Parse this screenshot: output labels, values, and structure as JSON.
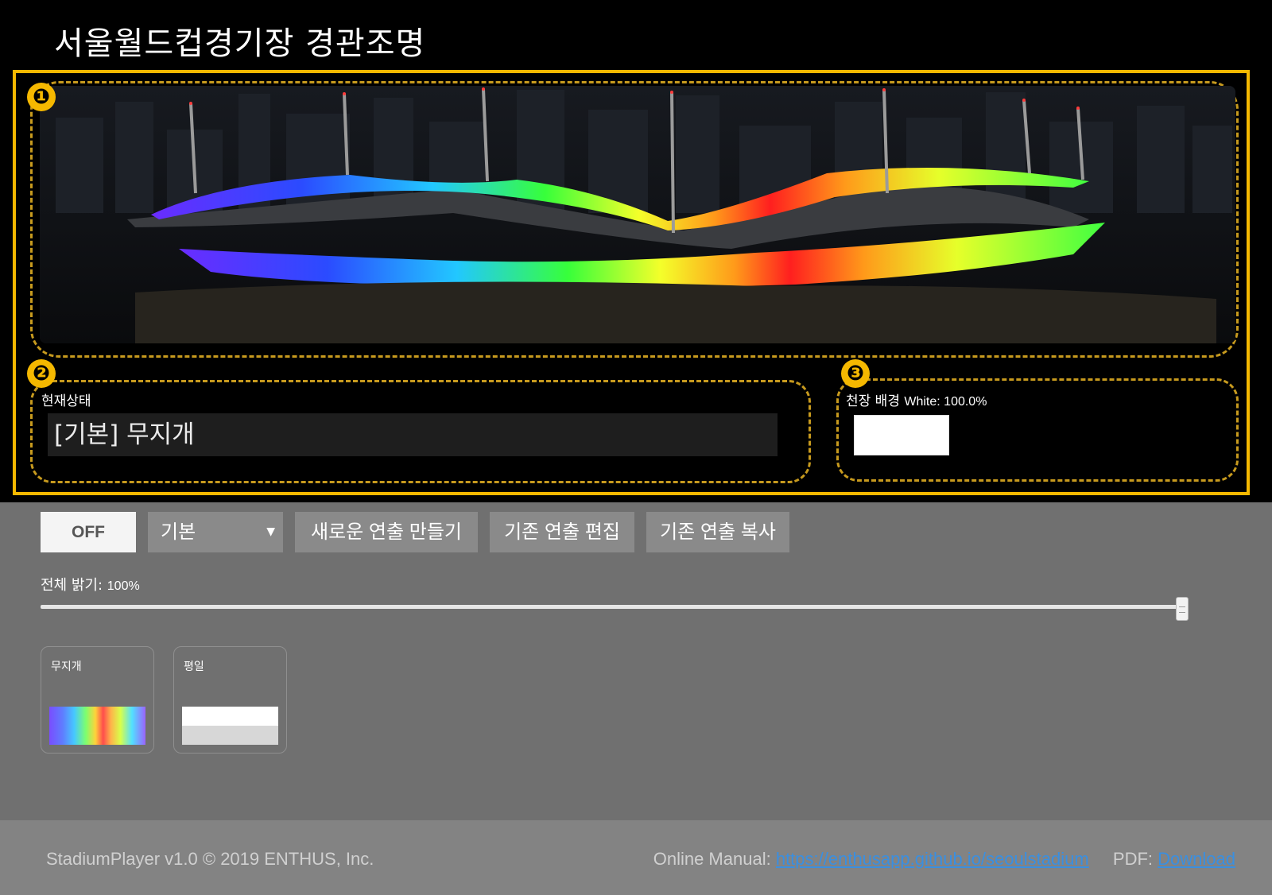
{
  "app": {
    "title": "서울월드컵경기장 경관조명"
  },
  "badges": {
    "stage": "❶",
    "status": "❷",
    "ceiling": "❸"
  },
  "status": {
    "label": "현재상태",
    "value": "[기본] 무지개"
  },
  "ceiling": {
    "label": "천장 배경",
    "value": "White: 100.0%",
    "color": "#ffffff"
  },
  "toolbar": {
    "power_label": "OFF",
    "preset_select": {
      "selected": "기본",
      "caret": "▼"
    },
    "new_show_label": "새로운 연출 만들기",
    "edit_show_label": "기존 연출 편집",
    "copy_show_label": "기존 연출 복사"
  },
  "brightness": {
    "label": "전체 밝기:",
    "value": "100%",
    "level": 1.0
  },
  "presets": [
    {
      "name": "무지개",
      "swatch": "rainbow"
    },
    {
      "name": "평일",
      "swatch": "white-gray"
    }
  ],
  "footer": {
    "copyright": "StadiumPlayer v1.0 © 2019 ENTHUS, Inc.",
    "manual_label": "Online Manual:",
    "manual_link": "https://enthusapp.github.io/seoulstadium",
    "pdf_label": "PDF:",
    "pdf_link": "Download"
  },
  "colors": {
    "accent": "#f5b800",
    "dash": "#c79a1e",
    "panel": "#707070",
    "footer": "#838383",
    "link": "#3a8fe0"
  }
}
